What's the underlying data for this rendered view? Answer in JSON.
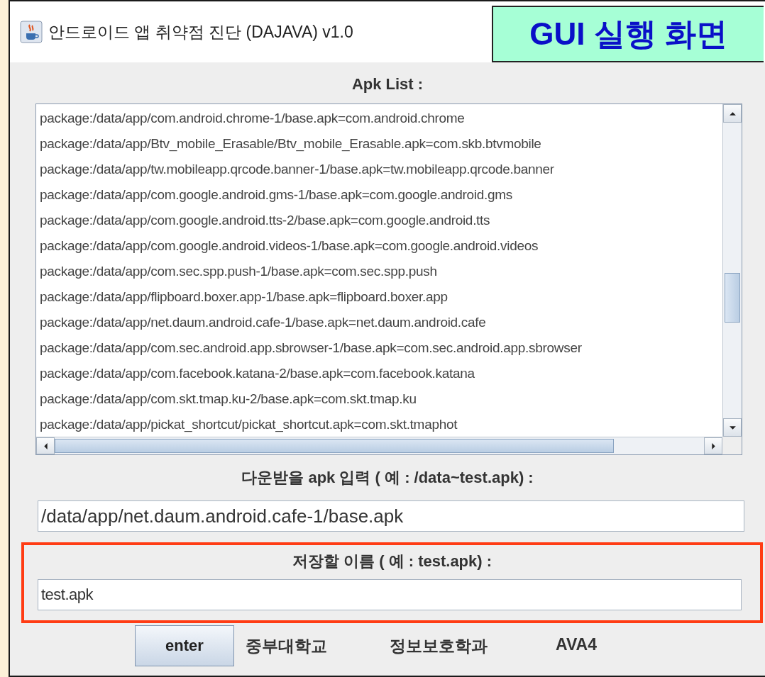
{
  "annotation": {
    "label": "GUI 실행 화면"
  },
  "window": {
    "title": "안드로이드 앱 취약점 진단 (DAJAVA) v1.0"
  },
  "apk_list": {
    "label": "Apk List :",
    "items": [
      "package:/data/app/com.android.chrome-1/base.apk=com.android.chrome",
      "package:/data/app/Btv_mobile_Erasable/Btv_mobile_Erasable.apk=com.skb.btvmobile",
      "package:/data/app/tw.mobileapp.qrcode.banner-1/base.apk=tw.mobileapp.qrcode.banner",
      "package:/data/app/com.google.android.gms-1/base.apk=com.google.android.gms",
      "package:/data/app/com.google.android.tts-2/base.apk=com.google.android.tts",
      "package:/data/app/com.google.android.videos-1/base.apk=com.google.android.videos",
      "package:/data/app/com.sec.spp.push-1/base.apk=com.sec.spp.push",
      "package:/data/app/flipboard.boxer.app-1/base.apk=flipboard.boxer.app",
      "package:/data/app/net.daum.android.cafe-1/base.apk=net.daum.android.cafe",
      "package:/data/app/com.sec.android.app.sbrowser-1/base.apk=com.sec.android.app.sbrowser",
      "package:/data/app/com.facebook.katana-2/base.apk=com.facebook.katana",
      "package:/data/app/com.skt.tmap.ku-2/base.apk=com.skt.tmap.ku",
      "package:/data/app/pickat_shortcut/pickat_shortcut.apk=com.skt.tmaphot"
    ]
  },
  "download_field": {
    "label": "다운받을 apk 입력 ( 예 : /data~test.apk) :",
    "value": "/data/app/net.daum.android.cafe-1/base.apk"
  },
  "save_name_field": {
    "label": "저장할 이름 ( 예 : test.apk) :",
    "value": "test.apk",
    "highlighted": true
  },
  "enter_button": "enter",
  "footer_texts": [
    "중부대학교",
    "정보보호학과",
    "AVA4"
  ]
}
